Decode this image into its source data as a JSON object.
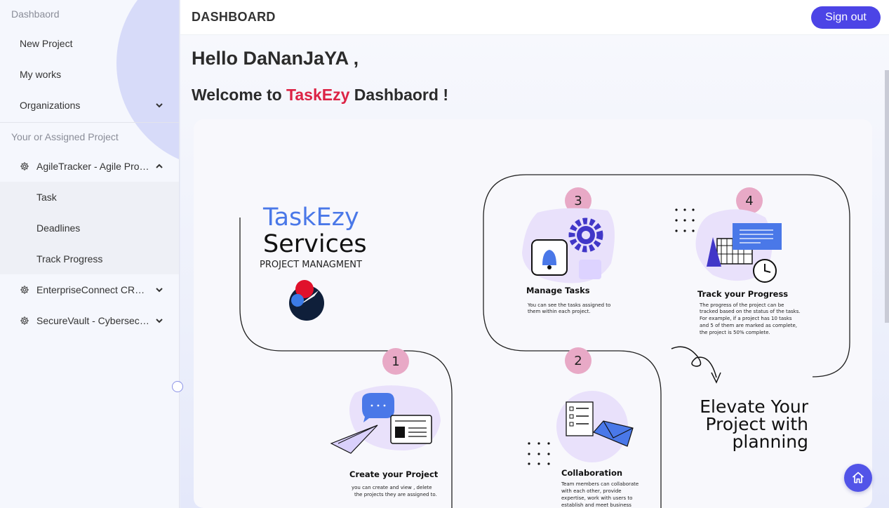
{
  "sidebar": {
    "section_dashboard": "Dashbaord",
    "items": [
      {
        "label": "New Project"
      },
      {
        "label": "My works"
      },
      {
        "label": "Organizations"
      }
    ],
    "section_projects": "Your or Assigned Project",
    "projects": [
      {
        "label": "AgileTracker - Agile Project Management",
        "expanded": true,
        "subitems": [
          {
            "label": "Task"
          },
          {
            "label": "Deadlines"
          },
          {
            "label": "Track Progress"
          }
        ]
      },
      {
        "label": "EnterpriseConnect CRM Suite",
        "expanded": false
      },
      {
        "label": "SecureVault - Cybersecurity",
        "expanded": false
      }
    ]
  },
  "header": {
    "title": "DASHBOARD",
    "signout_label": "Sign out"
  },
  "main": {
    "hello": "Hello DaNanJaYA ,",
    "welcome_prefix": "Welcome to ",
    "welcome_brand": "TaskEzy",
    "welcome_suffix": " Dashbaord !"
  },
  "infographic": {
    "brand": "TaskEzy",
    "services": "Services",
    "subtitle": "PROJECT MANAGMENT",
    "steps": [
      {
        "num": "1",
        "title": "Create your Project",
        "lines": [
          "you  can create and  view , delete",
          "the projects they are assigned to."
        ]
      },
      {
        "num": "2",
        "title": "Collaboration",
        "lines": [
          "Team members can collaborate",
          "with each other, provide",
          "expertise, work with users to",
          "establish and meet business"
        ]
      },
      {
        "num": "3",
        "title": "Manage Tasks",
        "lines": [
          "You can see the tasks assigned to",
          "them within each project."
        ]
      },
      {
        "num": "4",
        "title": "Track your Progress",
        "lines": [
          "The progress of the project can be",
          "tracked based on the status of the tasks.",
          "For example, if a project has 10 tasks",
          "and 5 of them are marked as complete,",
          "the project is 50% complete."
        ]
      }
    ],
    "tagline": [
      "Elevate Your",
      "Project with",
      "planning"
    ]
  },
  "colors": {
    "accent": "#4c44e6",
    "brand_red": "#dc2345",
    "brand_blue": "#4a78e8",
    "step_badge": "#e8a9c6"
  },
  "icons": {
    "gear": "gear-icon",
    "chevron_down": "chevron-down-icon",
    "chevron_up": "chevron-up-icon",
    "home": "home-icon"
  }
}
